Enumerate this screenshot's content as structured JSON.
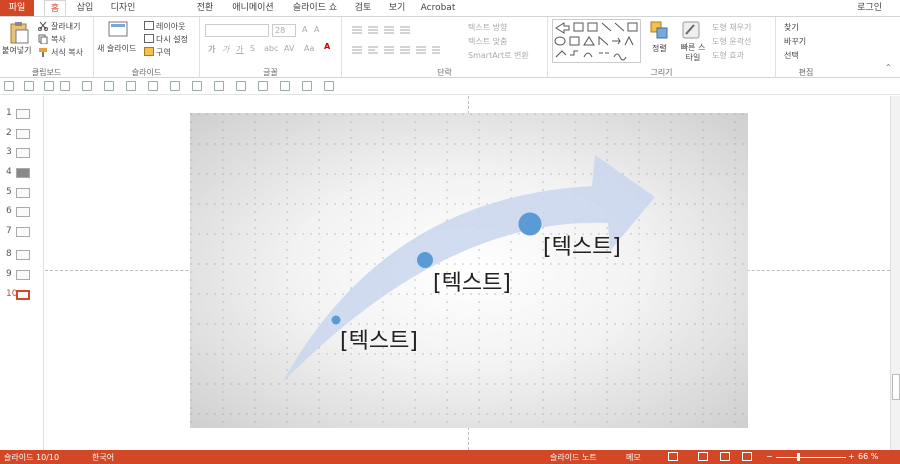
{
  "tabs": [
    "파일",
    "홈",
    "삽입",
    "디자인",
    "전환",
    "애니메이션",
    "슬라이드 쇼",
    "검토",
    "보기",
    "Acrobat"
  ],
  "login": "로그인",
  "clipboard": {
    "paste": "붙여넣기",
    "cut": "잘라내기",
    "copy": "복사",
    "format_painter": "서식 복사",
    "label": "클립보드"
  },
  "slides": {
    "new_slide": "새 슬라이드",
    "layout": "레이아웃",
    "reset": "다시 설정",
    "section": "구역",
    "label": "슬라이드"
  },
  "font": {
    "name": "",
    "size": "28",
    "label": "글꼴",
    "bold": "가",
    "italic": "가",
    "grow": "A",
    "shrink": "A",
    "aa": "Aa"
  },
  "paragraph": {
    "text_direction": "텍스트 방향",
    "align_text": "텍스트 맞춤",
    "smartart": "SmartArt로 변환",
    "label": "단락"
  },
  "drawing": {
    "arrange": "정렬",
    "quick_styles": "빠른 스타일",
    "fill": "도형 채우기",
    "outline": "도형 윤곽선",
    "effects": "도형 효과",
    "label": "그리기"
  },
  "editing": {
    "find": "찾기",
    "replace": "바꾸기",
    "select": "선택",
    "label": "편집"
  },
  "thumbnails": [
    "1",
    "2",
    "3",
    "4",
    "5",
    "6",
    "7",
    "8",
    "9",
    "10"
  ],
  "slide_texts": [
    "[텍스트]",
    "[텍스트]",
    "[텍스트]"
  ],
  "status": {
    "slide_info": "슬라이드 10/10",
    "language": "한국어",
    "notes": "슬라이드 노트",
    "comments": "메모",
    "zoom": "66 %"
  },
  "colors": {
    "accent": "#d24726",
    "arrow": "#c9d6ee",
    "dot": "#5b9bd5"
  }
}
